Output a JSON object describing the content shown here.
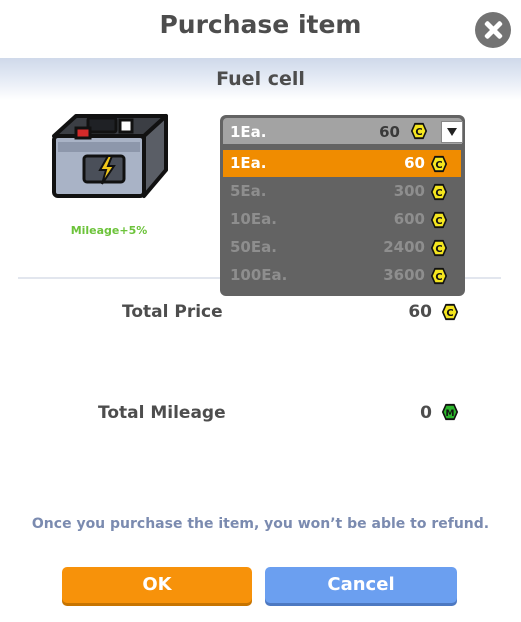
{
  "dialog": {
    "title": "Purchase item",
    "item_name": "Fuel cell",
    "item_effect": "Mileage+5%"
  },
  "quantity_dropdown": {
    "selected_quantity": "1Ea.",
    "selected_price": "60",
    "options": [
      {
        "quantity": "1Ea.",
        "price": "60",
        "selected": true
      },
      {
        "quantity": "5Ea.",
        "price": "300",
        "selected": false
      },
      {
        "quantity": "10Ea.",
        "price": "600",
        "selected": false
      },
      {
        "quantity": "50Ea.",
        "price": "2400",
        "selected": false
      },
      {
        "quantity": "100Ea.",
        "price": "3600",
        "selected": false
      }
    ]
  },
  "summary": {
    "total_price_label": "Total Price",
    "total_price_value": "60",
    "total_mileage_label": "Total Mileage",
    "total_mileage_value": "0"
  },
  "icons": {
    "coin_icon": "coin-c-icon",
    "mileage_icon": "mileage-m-icon",
    "close_icon": "close-icon",
    "item_icon": "battery-icon"
  },
  "notice": "Once you purchase the item, you won’t be able to refund.",
  "buttons": {
    "ok_label": "OK",
    "cancel_label": "Cancel"
  },
  "colors": {
    "selected_option": "#f08c00",
    "ok_button": "#f7920a",
    "cancel_button": "#6b9ff0",
    "coin": "#f5e61e",
    "mileage": "#2bb52b"
  }
}
